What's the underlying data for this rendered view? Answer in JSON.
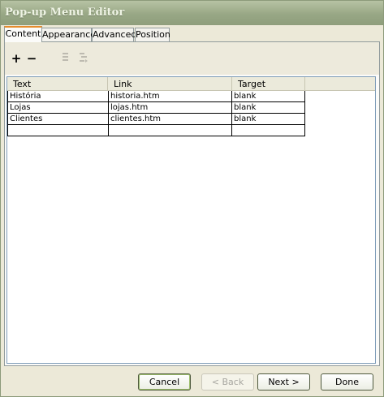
{
  "window": {
    "title": "Pop-up Menu Editor"
  },
  "tabs": [
    {
      "label": "Content",
      "active": true
    },
    {
      "label": "Appearance",
      "active": false
    },
    {
      "label": "Advanced",
      "active": false
    },
    {
      "label": "Position",
      "active": false
    }
  ],
  "toolbar": {
    "add_icon": "plus-icon",
    "remove_icon": "minus-icon",
    "indent_icon": "indent-icon",
    "outdent_icon": "outdent-icon"
  },
  "grid": {
    "columns": [
      "Text",
      "Link",
      "Target"
    ],
    "rows": [
      [
        "História",
        "historia.htm",
        "blank"
      ],
      [
        "Lojas",
        "lojas.htm",
        "blank"
      ],
      [
        "Clientes",
        "clientes.htm",
        "blank"
      ],
      [
        "",
        "",
        ""
      ]
    ]
  },
  "footer": {
    "cancel_label": "Cancel",
    "back_label": "< Back",
    "next_label": "Next >",
    "done_label": "Done"
  }
}
